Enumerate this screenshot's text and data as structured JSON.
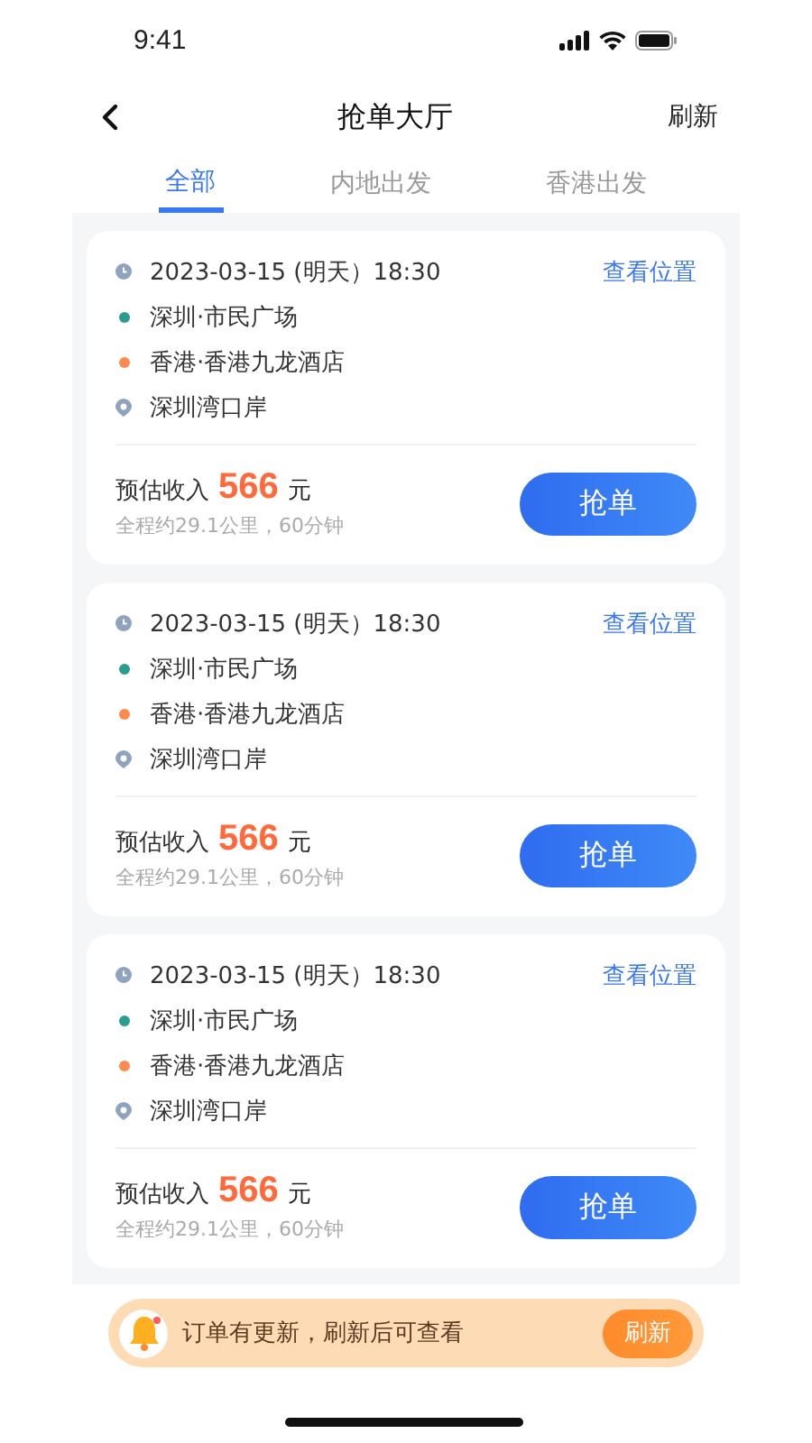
{
  "status_bar": {
    "time": "9:41"
  },
  "nav": {
    "title": "抢单大厅",
    "action": "刷新"
  },
  "tabs": [
    {
      "label": "全部",
      "selected": true
    },
    {
      "label": "内地出发",
      "selected": false
    },
    {
      "label": "香港出发",
      "selected": false
    }
  ],
  "orders": [
    {
      "time": "2023-03-15 (明天）18:30",
      "link": "查看位置",
      "stops": [
        {
          "kind": "start",
          "name": "深圳·市民广场"
        },
        {
          "kind": "end",
          "name": "香港·香港九龙酒店"
        },
        {
          "kind": "via",
          "name": "深圳湾口岸"
        }
      ],
      "income_label": "预估收入",
      "amount": "566",
      "unit": "元",
      "summary": "全程约29.1公里，60分钟",
      "button": "抢单"
    },
    {
      "time": "2023-03-15 (明天）18:30",
      "link": "查看位置",
      "stops": [
        {
          "kind": "start",
          "name": "深圳·市民广场"
        },
        {
          "kind": "end",
          "name": "香港·香港九龙酒店"
        },
        {
          "kind": "via",
          "name": "深圳湾口岸"
        }
      ],
      "income_label": "预估收入",
      "amount": "566",
      "unit": "元",
      "summary": "全程约29.1公里，60分钟",
      "button": "抢单"
    },
    {
      "time": "2023-03-15 (明天）18:30",
      "link": "查看位置",
      "stops": [
        {
          "kind": "start",
          "name": "深圳·市民广场"
        },
        {
          "kind": "end",
          "name": "香港·香港九龙酒店"
        },
        {
          "kind": "via",
          "name": "深圳湾口岸"
        }
      ],
      "income_label": "预估收入",
      "amount": "566",
      "unit": "元",
      "summary": "全程约29.1公里，60分钟",
      "button": "抢单"
    }
  ],
  "notice": {
    "text": "订单有更新，刷新后可查看",
    "button": "刷新"
  }
}
